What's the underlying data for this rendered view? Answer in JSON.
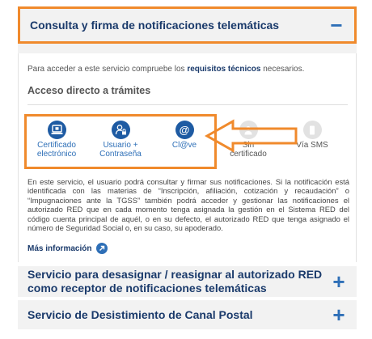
{
  "panels": [
    {
      "title": "Consulta y firma de notificaciones telemáticas",
      "toggle": "−",
      "expanded": true
    },
    {
      "title_line1": "Servicio para desasignar / reasignar al autorizado RED",
      "title_line2": "como receptor de notificaciones telemáticas",
      "toggle": "+",
      "expanded": false
    },
    {
      "title": "Servicio de Desistimiento de Canal Postal",
      "toggle": "+",
      "expanded": false
    }
  ],
  "intro": {
    "before": "Para acceder a este servicio compruebe los ",
    "link": "requisitos técnicos",
    "after": " necesarios."
  },
  "section_title": "Acceso directo a trámites",
  "access": [
    {
      "line1": "Certificado",
      "line2": "electrónico",
      "icon": "certificate-laptop-icon",
      "enabled": true
    },
    {
      "line1": "Usuario +",
      "line2": "Contraseña",
      "icon": "user-lock-icon",
      "enabled": true
    },
    {
      "line1": "Cl@ve",
      "line2": "",
      "icon": "clave-at-icon",
      "enabled": true
    },
    {
      "line1": "Sin",
      "line2": "certificado",
      "icon": "person-icon",
      "enabled": false
    },
    {
      "line1": "Vía SMS",
      "line2": "",
      "icon": "sms-icon",
      "enabled": false
    }
  ],
  "description": "En este servicio, el usuario podrá consultar y firmar sus notificaciones. Si la notificación está identificada con las materias de “Inscripción, afiliación, cotización y recaudación” o “Impugnaciones ante la TGSS” también podrá acceder y gestionar las notificaciones el autorizado RED que en cada momento tenga asignada la gestión en el Sistema RED del código cuenta principal de aquél, o en su defecto, el autorizado RED que tenga asignado el número de Seguridad Social o, en su caso, su apoderado.",
  "more_info": "Más información",
  "colors": {
    "highlight": "#f08a2c",
    "brand": "#1a3a6b",
    "accent": "#2e6fb7",
    "icon_blue": "#1e5ba3"
  }
}
